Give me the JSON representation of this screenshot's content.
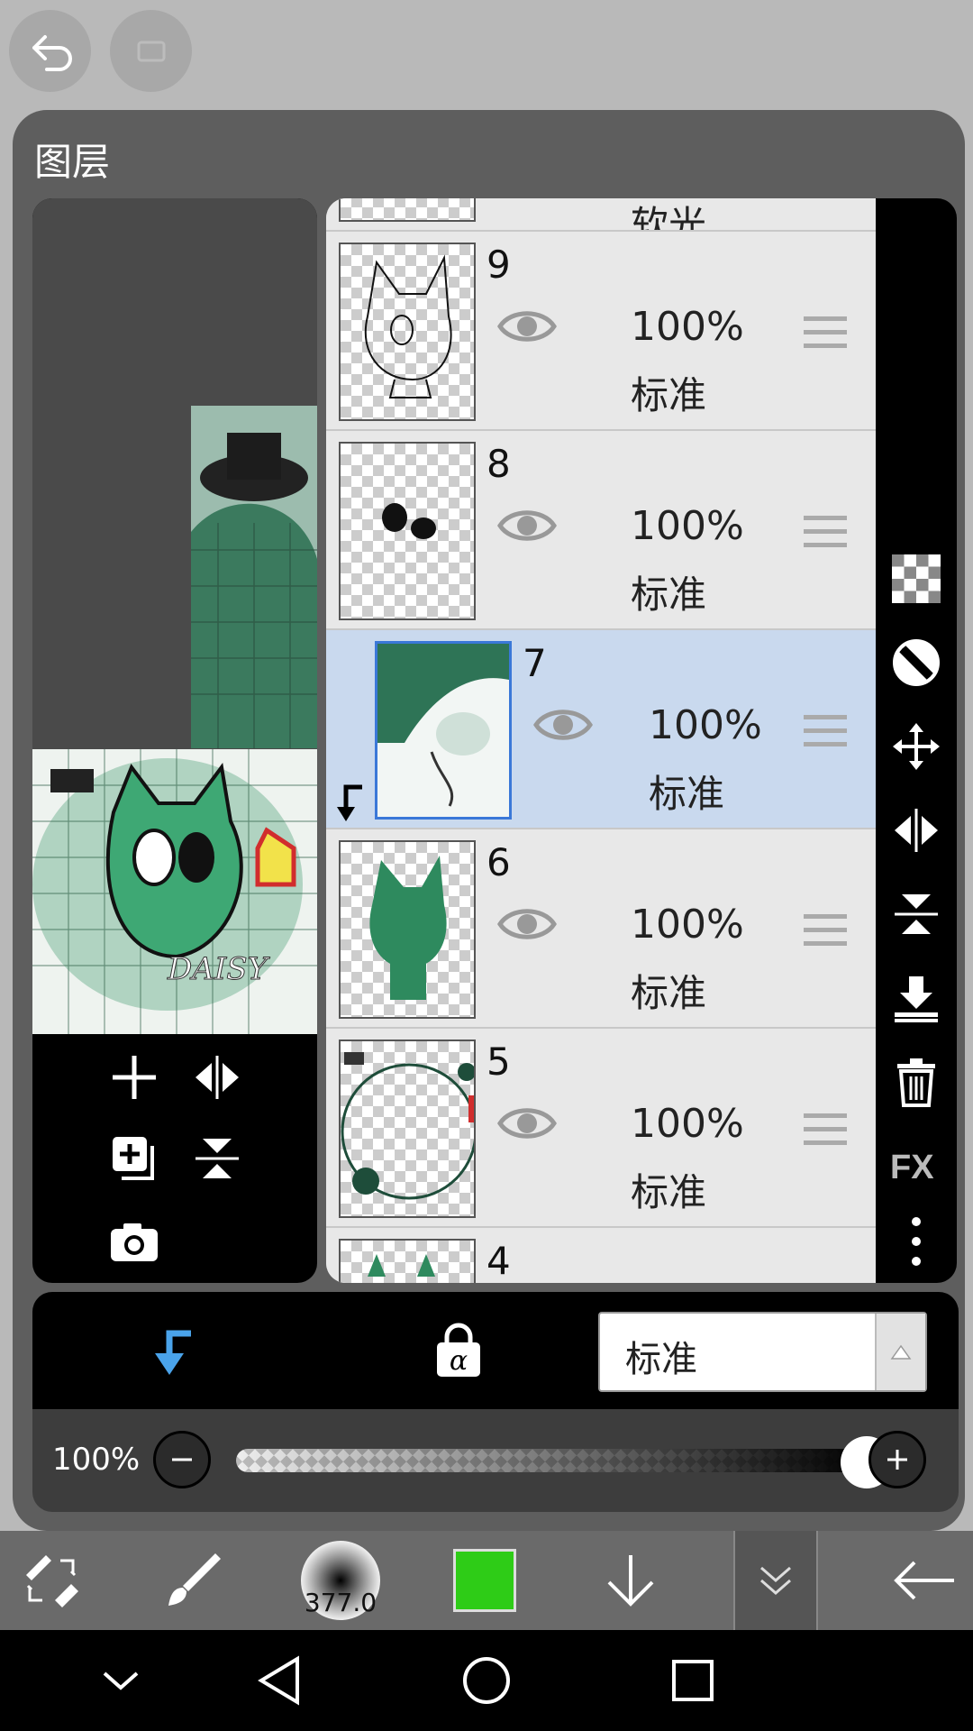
{
  "panel": {
    "title": "图层"
  },
  "layers": [
    {
      "number": "",
      "opacity": "",
      "blend": "软光",
      "partial": "top"
    },
    {
      "number": "9",
      "opacity": "100%",
      "blend": "标准"
    },
    {
      "number": "8",
      "opacity": "100%",
      "blend": "标准"
    },
    {
      "number": "7",
      "opacity": "100%",
      "blend": "标准",
      "selected": true,
      "clipped": true
    },
    {
      "number": "6",
      "opacity": "100%",
      "blend": "标准"
    },
    {
      "number": "5",
      "opacity": "100%",
      "blend": "标准"
    },
    {
      "number": "4",
      "opacity": "",
      "blend": "",
      "partial": "bottom"
    }
  ],
  "blend_mode": {
    "selected": "标准"
  },
  "opacity_control": {
    "label": "100%",
    "value": 1.0
  },
  "bottom_toolbar": {
    "brush_size": "377.0",
    "color": "#2ecc17"
  },
  "preview": {
    "art_text": "DAISY"
  }
}
